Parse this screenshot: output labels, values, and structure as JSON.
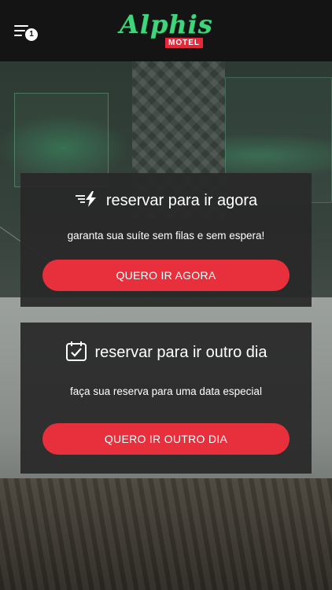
{
  "header": {
    "menu_badge": "1",
    "logo_text": "Alphis",
    "logo_sub": "MOTEL"
  },
  "cards": [
    {
      "title": "reservar para ir agora",
      "description": "garanta sua suíte sem filas e sem espera!",
      "button": "QUERO IR AGORA",
      "icon": "fast-lightning-icon"
    },
    {
      "title": "reservar para ir outro dia",
      "description": "faça sua reserva para uma data especial",
      "button": "QUERO IR OUTRO DIA",
      "icon": "calendar-check-icon"
    }
  ],
  "colors": {
    "accent": "#e8303c",
    "brand_green": "#3fd57a",
    "card_bg": "#282828",
    "topbar_bg": "#141414"
  }
}
